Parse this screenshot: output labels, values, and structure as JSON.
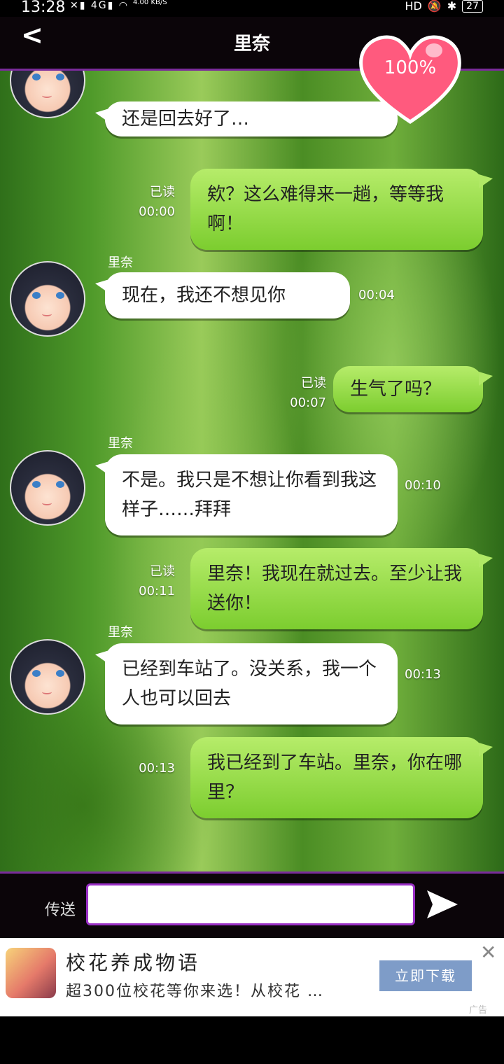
{
  "status": {
    "time": "13:28",
    "signal": "4G",
    "speed": "4.00\nKB/S",
    "icons": [
      "hd-icon",
      "mute-bell-icon",
      "bluetooth-icon"
    ],
    "battery": "27"
  },
  "header": {
    "title": "里奈",
    "affection": "100%"
  },
  "messages": [
    {
      "side": "in",
      "text": "还是回去好了…"
    },
    {
      "side": "out",
      "text": "欸？这么难得来一趟，等等我啊！",
      "read": "已读",
      "time": "00:00"
    },
    {
      "side": "in",
      "sender": "里奈",
      "text": "现在，我还不想见你",
      "time": "00:04"
    },
    {
      "side": "out",
      "text": "生气了吗？",
      "read": "已读",
      "time": "00:07"
    },
    {
      "side": "in",
      "sender": "里奈",
      "text": "不是。我只是不想让你看到我这样子……拜拜",
      "time": "00:10"
    },
    {
      "side": "out",
      "text": "里奈！我现在就过去。至少让我送你！",
      "read": "已读",
      "time": "00:11"
    },
    {
      "side": "in",
      "sender": "里奈",
      "text": "已经到车站了。没关系，我一个人也可以回去",
      "time": "00:13"
    },
    {
      "side": "out",
      "text": "我已经到了车站。里奈，你在哪里？",
      "time": "00:13"
    }
  ],
  "input": {
    "label": "传送",
    "value": ""
  },
  "ad": {
    "title": "校花养成物语",
    "desc": "超300位校花等你来选！从校花 …",
    "button": "立即下载",
    "tag": "广告"
  }
}
